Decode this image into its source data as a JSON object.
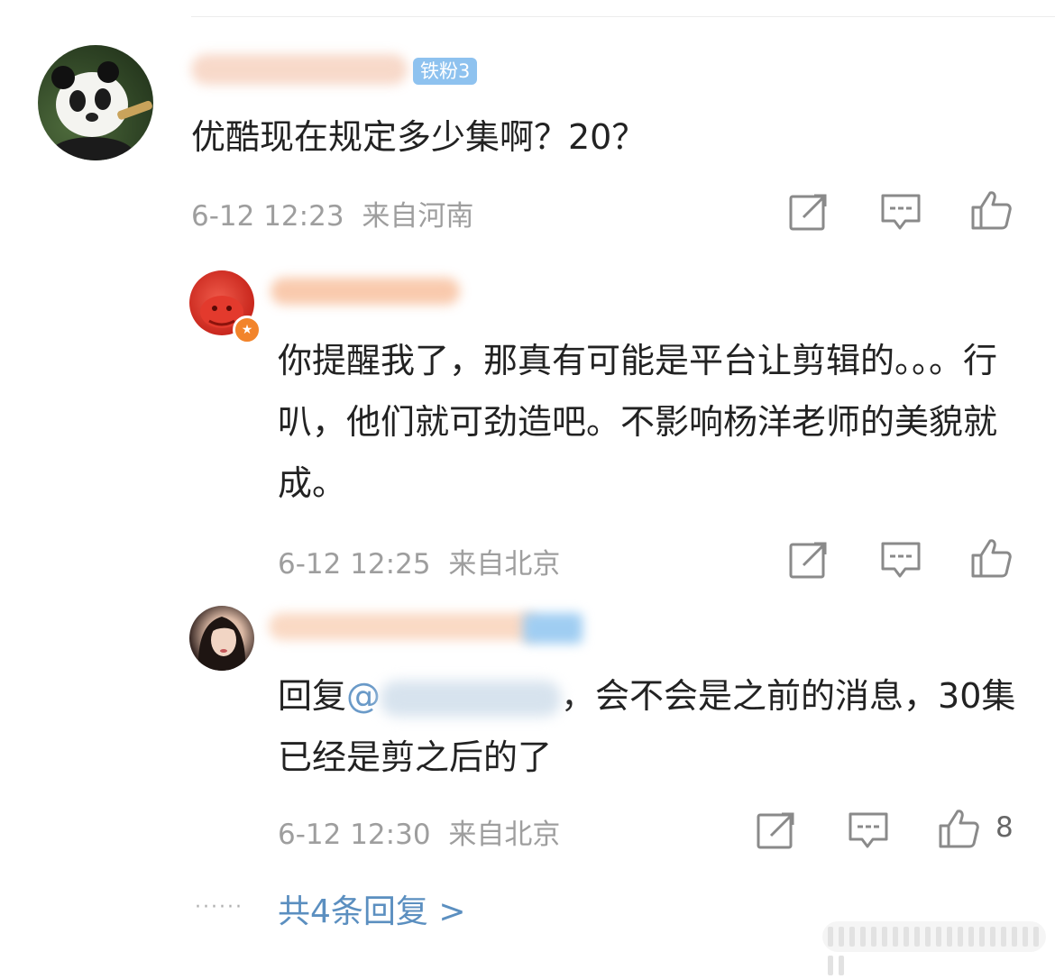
{
  "comments": [
    {
      "badge": "铁粉3",
      "text": "优酷现在规定多少集啊？20？",
      "time": "6-12 12:23",
      "location": "来自河南"
    },
    {
      "text": "你提醒我了，那真有可能是平台让剪辑的。。。行叭，他们就可劲造吧。不影响杨洋老师的美貌就成。",
      "time": "6-12 12:25",
      "location": "来自北京"
    },
    {
      "reply_prefix": "回复",
      "mention_at": "@",
      "text_after": "，会不会是之前的消息，30集已经是剪之后的了",
      "time": "6-12 12:30",
      "location": "来自北京",
      "likes": "8"
    }
  ],
  "more_replies": "共4条回复 >",
  "icons": [
    "share-icon",
    "comment-icon",
    "like-icon"
  ]
}
